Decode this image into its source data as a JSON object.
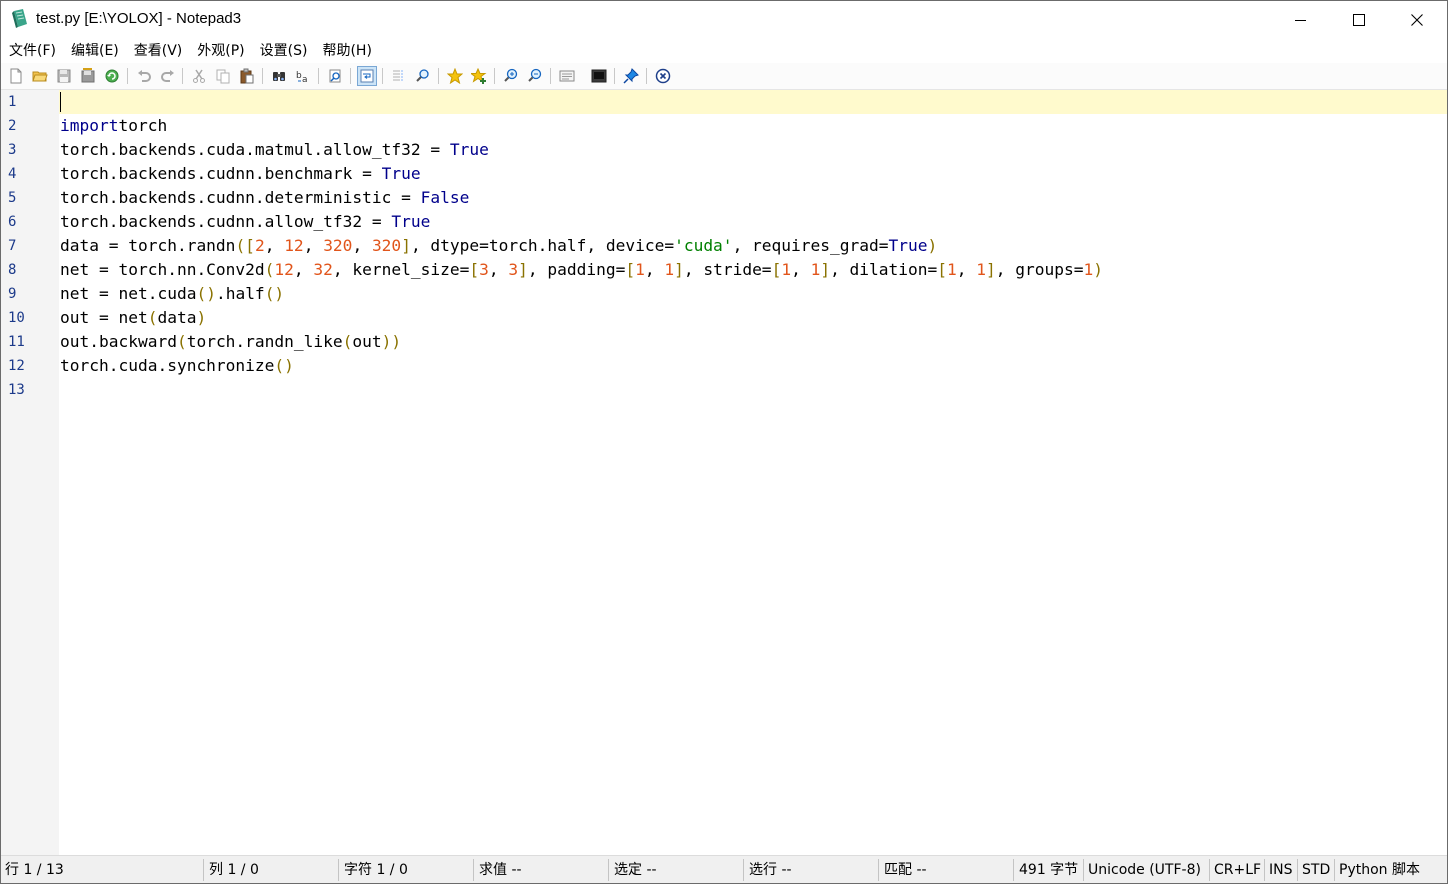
{
  "window": {
    "title": "test.py [E:\\YOLOX] - Notepad3",
    "icon": "notepad3-app-icon"
  },
  "window_controls": [
    "minimize-icon",
    "maximize-icon",
    "close-icon"
  ],
  "menu": [
    "文件(F)",
    "编辑(E)",
    "查看(V)",
    "外观(P)",
    "设置(S)",
    "帮助(H)"
  ],
  "toolbar": [
    "new-file-icon",
    "open-folder-icon",
    "save-icon",
    "save-as-icon",
    "revert-icon",
    "undo-icon",
    "redo-icon",
    "cut-icon",
    "copy-icon",
    "paste-icon",
    "find-icon",
    "replace-icon",
    "goto-icon",
    "word-wrap-icon",
    "long-line-marker-icon",
    "zoom-find-icon",
    "favorites-icon",
    "add-favorite-icon",
    "zoom-in-icon",
    "zoom-out-icon",
    "view-schemes-icon",
    "customize-schemes-icon",
    "always-on-top-icon",
    "exit-icon"
  ],
  "editor": {
    "line_numbers": [
      "1",
      "2",
      "3",
      "4",
      "5",
      "6",
      "7",
      "8",
      "9",
      "10",
      "11",
      "12",
      "13"
    ],
    "current_line_index": 0,
    "colors": {
      "keyword": "#00008b",
      "number": "#e1551b",
      "string": "#008000",
      "bracket": "#8a7200",
      "current_line": "#fffacd",
      "gutter": "#f4f4f4",
      "line_number": "#1c3a8a"
    },
    "lines": [
      [],
      [
        [
          "kw",
          "import"
        ],
        [
          "",
          "torch"
        ]
      ],
      [
        [
          "",
          "torch.backends.cuda.matmul.allow_tf32 = "
        ],
        [
          "kw",
          "True"
        ]
      ],
      [
        [
          "",
          "torch.backends.cudnn.benchmark = "
        ],
        [
          "kw",
          "True"
        ]
      ],
      [
        [
          "",
          "torch.backends.cudnn.deterministic = "
        ],
        [
          "kw",
          "False"
        ]
      ],
      [
        [
          "",
          "torch.backends.cudnn.allow_tf32 = "
        ],
        [
          "kw",
          "True"
        ]
      ],
      [
        [
          "",
          "data = torch.randn"
        ],
        [
          "br",
          "(["
        ],
        [
          "num",
          "2"
        ],
        [
          "",
          ", "
        ],
        [
          "num",
          "12"
        ],
        [
          "",
          ", "
        ],
        [
          "num",
          "320"
        ],
        [
          "",
          ", "
        ],
        [
          "num",
          "320"
        ],
        [
          "br",
          "]"
        ],
        [
          "",
          ", dtype=torch.half, device="
        ],
        [
          "str",
          "'cuda'"
        ],
        [
          "",
          ", requires_grad="
        ],
        [
          "kw",
          "True"
        ],
        [
          "br",
          ")"
        ]
      ],
      [
        [
          "",
          "net = torch.nn.Conv2d"
        ],
        [
          "br",
          "("
        ],
        [
          "num",
          "12"
        ],
        [
          "",
          ", "
        ],
        [
          "num",
          "32"
        ],
        [
          "",
          ", kernel_size="
        ],
        [
          "br",
          "["
        ],
        [
          "num",
          "3"
        ],
        [
          "",
          ", "
        ],
        [
          "num",
          "3"
        ],
        [
          "br",
          "]"
        ],
        [
          "",
          ", padding="
        ],
        [
          "br",
          "["
        ],
        [
          "num",
          "1"
        ],
        [
          "",
          ", "
        ],
        [
          "num",
          "1"
        ],
        [
          "br",
          "]"
        ],
        [
          "",
          ", stride="
        ],
        [
          "br",
          "["
        ],
        [
          "num",
          "1"
        ],
        [
          "",
          ", "
        ],
        [
          "num",
          "1"
        ],
        [
          "br",
          "]"
        ],
        [
          "",
          ", dilation="
        ],
        [
          "br",
          "["
        ],
        [
          "num",
          "1"
        ],
        [
          "",
          ", "
        ],
        [
          "num",
          "1"
        ],
        [
          "br",
          "]"
        ],
        [
          "",
          ", groups="
        ],
        [
          "num",
          "1"
        ],
        [
          "br",
          ")"
        ]
      ],
      [
        [
          "",
          "net = net.cuda"
        ],
        [
          "br",
          "()"
        ],
        [
          "",
          ".half"
        ],
        [
          "br",
          "()"
        ]
      ],
      [
        [
          "",
          "out = net"
        ],
        [
          "br",
          "("
        ],
        [
          "",
          "data"
        ],
        [
          "br",
          ")"
        ]
      ],
      [
        [
          "",
          "out.backward"
        ],
        [
          "br",
          "("
        ],
        [
          "",
          "torch.randn_like"
        ],
        [
          "br",
          "("
        ],
        [
          "",
          "out"
        ],
        [
          "br",
          "))"
        ]
      ],
      [
        [
          "",
          "torch.cuda.synchronize"
        ],
        [
          "br",
          "()"
        ]
      ],
      []
    ]
  },
  "status": {
    "line": "行  1 / 13",
    "column": "列  1 / 0",
    "char": "字符  1 / 0",
    "sum": "求值  --",
    "selection": "选定  --",
    "selected_lines": "选行  --",
    "match": "匹配  --",
    "bytes": "491 字节",
    "encoding": "Unicode (UTF-8)",
    "eol": "CR+LF",
    "ovr": "INS",
    "std": "STD",
    "lexer": "Python 脚本"
  }
}
